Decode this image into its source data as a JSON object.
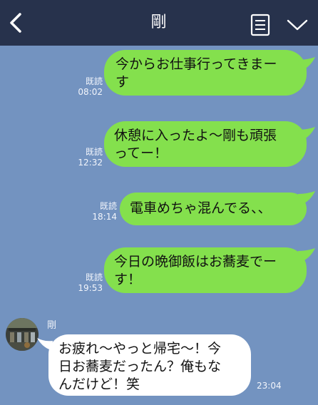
{
  "header": {
    "title": "剛",
    "back_icon": "chevron-left-icon",
    "menu_icon": "list-icon",
    "expand_icon": "chevron-down-icon",
    "bg_color": "#27324c"
  },
  "chat": {
    "bg_color": "#7393c0",
    "outgoing_color": "#84e04d",
    "incoming_color": "#ffffff",
    "messages": [
      {
        "direction": "out",
        "text": "今からお仕事行ってきまー\nす",
        "read": "既読",
        "time": "08:02"
      },
      {
        "direction": "out",
        "text": "休憩に入ったよ〜剛も頑張\nってー！",
        "read": "既読",
        "time": "12:32"
      },
      {
        "direction": "out",
        "text": "電車めちゃ混んでる、、",
        "read": "既読",
        "time": "18:14"
      },
      {
        "direction": "out",
        "text": "今日の晩御飯はお蕎麦でー\nす！",
        "read": "既読",
        "time": "19:53"
      },
      {
        "direction": "in",
        "sender": "剛",
        "text": "お疲れ〜やっと帰宅〜！今\n日お蕎麦だったん？俺もな\nんだけど！笑",
        "time": "23:04"
      }
    ]
  }
}
